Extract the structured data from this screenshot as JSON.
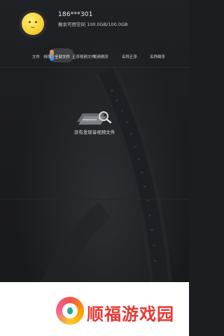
{
  "user": {
    "username": "186***301",
    "storage_text": "剩余可用空间 100.0GB/100.0GB"
  },
  "tabs": [
    {
      "label": "文件"
    },
    {
      "label": "排序"
    },
    {
      "label": "全部文件"
    },
    {
      "label": "正序视频文件"
    },
    {
      "label": "视频倒序"
    },
    {
      "label": "名称正序"
    },
    {
      "label": "名称倒序"
    }
  ],
  "empty_state": {
    "message": "没有发现音视频文件"
  },
  "footer": {
    "brand_name": "顺福游戏园"
  },
  "colors": {
    "background": "#1c1d21",
    "footer_background": "#ffffff",
    "brand_red": "#e53935",
    "accent_orange": "#ff9a2f",
    "accent_blue": "#1f8bff"
  },
  "icons": {
    "empty_icon": "video-search-icon",
    "avatar": "smiley-avatar-icon",
    "brand_logo": "brand-logo-icon"
  }
}
